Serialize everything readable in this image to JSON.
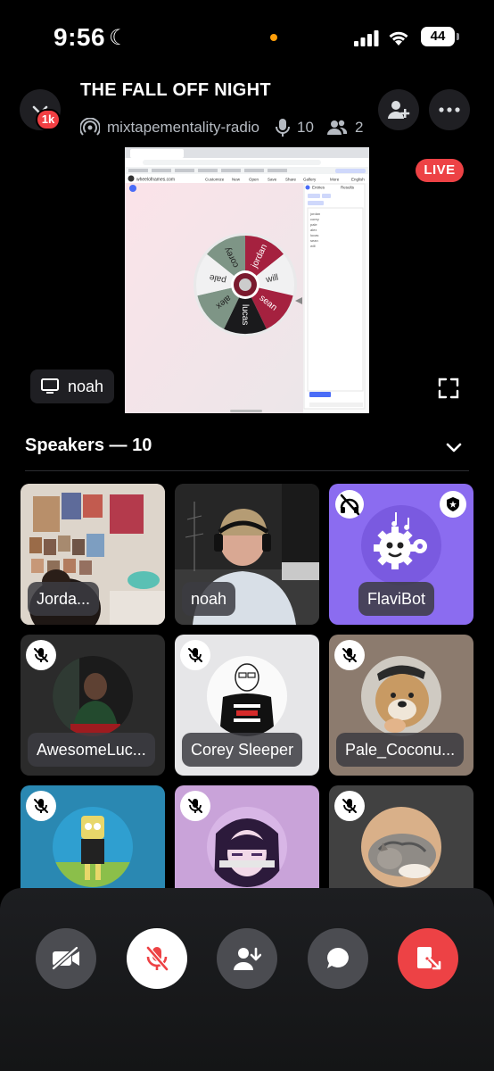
{
  "status_bar": {
    "time": "9:56",
    "battery": "44"
  },
  "header": {
    "back_badge": "1k",
    "title": "THE FALL OFF NIGHT",
    "channel": "mixtapementality-radio",
    "speaker_count": "10",
    "listener_count": "2"
  },
  "stream": {
    "live_label": "LIVE",
    "streamer": "noah",
    "wheel_site": "wheelofnames.com",
    "wheel_entries": [
      "jordan",
      "will",
      "sean",
      "lucas",
      "alex",
      "pale",
      "corey"
    ],
    "tabs": {
      "entries": "Entries",
      "results": "Results"
    },
    "menu": [
      "Customize",
      "New",
      "Open",
      "Save",
      "Share",
      "Gallery",
      "More",
      "English"
    ]
  },
  "speakers": {
    "heading": "Speakers — 10",
    "tiles": [
      {
        "name": "Jorda...",
        "muted": false
      },
      {
        "name": "noah",
        "muted": false
      },
      {
        "name": "FlaviBot",
        "muted": true
      },
      {
        "name": "AwesomeLuc...",
        "muted": true
      },
      {
        "name": "Corey Sleeper",
        "muted": true
      },
      {
        "name": "Pale_Coconu...",
        "muted": true
      },
      {
        "name": "",
        "muted": true
      },
      {
        "name": "",
        "muted": true
      },
      {
        "name": "",
        "muted": true
      }
    ]
  },
  "colors": {
    "danger": "#ed4245",
    "flavibot": "#8b6cf0",
    "bottom_bar": "#1d1e21"
  }
}
